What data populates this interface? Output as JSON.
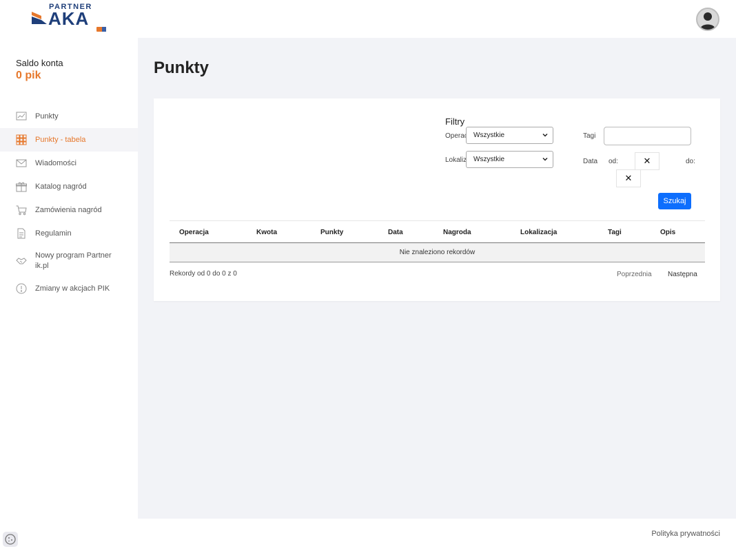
{
  "header": {
    "logo_partner": "PARTNER",
    "logo_name": "AKA"
  },
  "sidebar": {
    "saldo_label": "Saldo konta",
    "saldo_value": "0 pik",
    "items": [
      {
        "label": "Punkty",
        "icon": "chart-icon"
      },
      {
        "label": "Punkty - tabela",
        "icon": "grid-icon",
        "active": true
      },
      {
        "label": "Wiadomości",
        "icon": "envelope-icon"
      },
      {
        "label": "Katalog nagród",
        "icon": "gift-icon"
      },
      {
        "label": "Zamówienia nagród",
        "icon": "cart-icon"
      },
      {
        "label": "Regulamin",
        "icon": "document-icon"
      },
      {
        "label": "Nowy program Partner ik.pl",
        "icon": "handshake-icon"
      },
      {
        "label": "Zmiany w akcjach PIK",
        "icon": "info-icon"
      }
    ]
  },
  "main": {
    "title": "Punkty",
    "filters": {
      "title": "Filtry",
      "operation_label": "Operacja",
      "operation_value": "Wszystkie",
      "location_label": "Lokalizacja",
      "location_value": "Wszystkie",
      "tags_label": "Tagi",
      "tags_value": "",
      "date_label": "Data",
      "from_label": "od:",
      "to_label": "do:",
      "clear_glyph": "✕",
      "search_label": "Szukaj"
    },
    "table": {
      "columns": [
        "Operacja",
        "Kwota",
        "Punkty",
        "Data",
        "Nagroda",
        "Lokalizacja",
        "Tagi",
        "Opis"
      ],
      "empty_message": "Nie znaleziono rekordów",
      "records_info": "Rekordy od 0 do 0 z 0",
      "prev_label": "Poprzednia",
      "next_label": "Następna"
    }
  },
  "footer": {
    "privacy_label": "Polityka prywatności"
  },
  "colors": {
    "accent": "#e6782c",
    "brand_blue": "#1f3f7a",
    "button_blue": "#0d6efd",
    "main_bg": "#f2f3f7"
  }
}
